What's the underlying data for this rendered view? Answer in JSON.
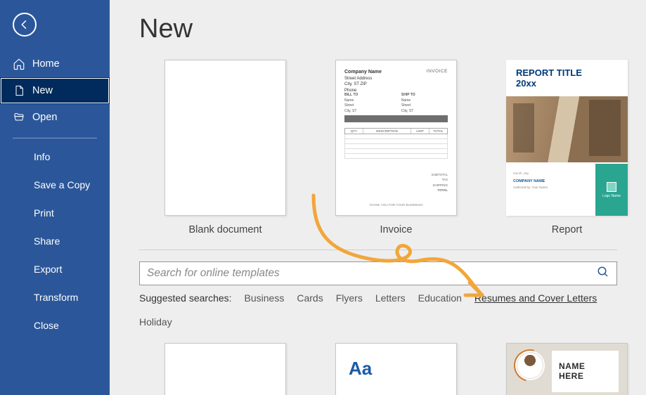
{
  "sidebar": {
    "nav": {
      "home": "Home",
      "new": "New",
      "open": "Open"
    },
    "sub": {
      "info": "Info",
      "save_copy": "Save a Copy",
      "print": "Print",
      "share": "Share",
      "export": "Export",
      "transform": "Transform",
      "close": "Close"
    }
  },
  "page": {
    "title": "New"
  },
  "templates": {
    "blank": "Blank document",
    "invoice": "Invoice",
    "report": "Report"
  },
  "invoice_thumb": {
    "company": "Company Name",
    "label": "INVOICE"
  },
  "report_thumb": {
    "title_l1": "REPORT TITLE",
    "title_l2": "20xx",
    "company": "COMPANY NAME",
    "author": "Authored by: Your Name",
    "logo_text": "Logo Name"
  },
  "search": {
    "placeholder": "Search for online templates"
  },
  "suggested": {
    "label": "Suggested searches:",
    "items": {
      "business": "Business",
      "cards": "Cards",
      "flyers": "Flyers",
      "letters": "Letters",
      "education": "Education",
      "resumes": "Resumes and Cover Letters",
      "holiday": "Holiday"
    }
  },
  "second_row": {
    "aa": "Aa",
    "name_l1": "NAME",
    "name_l2": "HERE"
  }
}
